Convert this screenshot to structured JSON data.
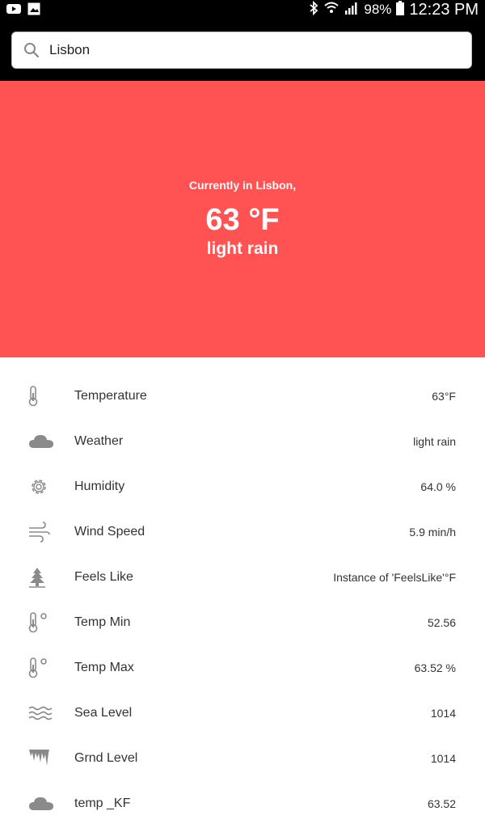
{
  "status_bar": {
    "battery": "98%",
    "time": "12:23 PM",
    "left_icons": [
      "youtube-icon",
      "gallery-icon"
    ],
    "right_icons": [
      "bluetooth-icon",
      "wifi-icon",
      "signal-icon",
      "battery-icon"
    ]
  },
  "search": {
    "value": "Lisbon",
    "icon": "search-icon"
  },
  "hero": {
    "subtitle": "Currently in Lisbon,",
    "temperature": "63 °F",
    "description": "light rain",
    "background": "#ff5252"
  },
  "rows": [
    {
      "icon": "thermometer-icon",
      "label": "Temperature",
      "value": "63°F"
    },
    {
      "icon": "cloud-icon",
      "label": "Weather",
      "value": "light rain"
    },
    {
      "icon": "gear-icon",
      "label": "Humidity",
      "value": "64.0 %"
    },
    {
      "icon": "wind-icon",
      "label": "Wind Speed",
      "value": "5.9 min/h"
    },
    {
      "icon": "tree-icon",
      "label": "Feels Like",
      "value": "Instance of 'FeelsLike'°F"
    },
    {
      "icon": "thermometer-degree-icon",
      "label": "Temp Min",
      "value": "52.56"
    },
    {
      "icon": "thermometer-degree-icon",
      "label": "Temp Max",
      "value": "63.52 %"
    },
    {
      "icon": "waves-icon",
      "label": "Sea Level",
      "value": "1014"
    },
    {
      "icon": "icicles-icon",
      "label": "Grnd Level",
      "value": "1014"
    },
    {
      "icon": "cloud-icon",
      "label": "temp _KF",
      "value": "63.52"
    }
  ],
  "colors": {
    "accent": "#ff5252",
    "icon_gray": "#8a8a8a",
    "text": "#333333"
  }
}
